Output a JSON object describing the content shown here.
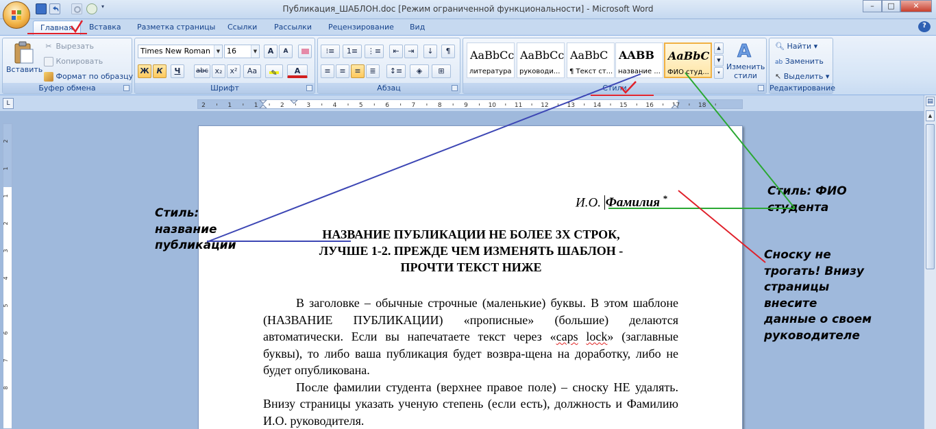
{
  "window": {
    "title": "Публикация_ШАБЛОН.doc [Режим ограниченной функциональности] - Microsoft Word",
    "minimize": "–",
    "maximize": "□",
    "close": "✕",
    "help": "?"
  },
  "tabs": [
    "Главная",
    "Вставка",
    "Разметка страницы",
    "Ссылки",
    "Рассылки",
    "Рецензирование",
    "Вид"
  ],
  "clipboard": {
    "label": "Буфер обмена",
    "paste": "Вставить",
    "cut": "Вырезать",
    "copy": "Копировать",
    "format_painter": "Формат по образцу"
  },
  "font": {
    "label": "Шрифт",
    "name": "Times New Roman",
    "size": "16",
    "grow": "A",
    "shrink": "A",
    "bold": "Ж",
    "italic": "К",
    "underline": "Ч",
    "strike": "abc",
    "subscript": "x₂",
    "superscript": "x²",
    "change_case": "Aa",
    "font_color": "A"
  },
  "paragraph": {
    "label": "Абзац"
  },
  "styles": {
    "label": "Стили",
    "change_styles": [
      "Изменить",
      "стили"
    ],
    "items": [
      {
        "sample": "AaBbCc",
        "name": "литература"
      },
      {
        "sample": "AaBbCc",
        "name": "руководи..."
      },
      {
        "sample": "AaBbC",
        "name": "¶ Текст ст..."
      },
      {
        "sample": "AABB",
        "name": "название ..."
      },
      {
        "sample": "AaBbC",
        "name": "ФИО студ..."
      }
    ]
  },
  "editing": {
    "label": "Редактирование",
    "find": "Найти",
    "replace": "Заменить",
    "select": "Выделить"
  },
  "ruler": {
    "corner": "L",
    "numbers": [
      "2",
      "1",
      "1",
      "2",
      "3",
      "4",
      "5",
      "6",
      "7",
      "8",
      "9",
      "10",
      "11",
      "12",
      "13",
      "14",
      "15",
      "16",
      "17",
      "18"
    ],
    "vnumbers": [
      "2",
      "1",
      "1",
      "2",
      "3",
      "4",
      "5",
      "6",
      "7",
      "8"
    ]
  },
  "document": {
    "author_initials": "И.О.",
    "author_surname": "Фамилия",
    "footnote_mark": "*",
    "heading": [
      "НАЗВАНИЕ ПУБЛИКАЦИИ НЕ БОЛЕЕ 3Х СТРОК,",
      "ЛУЧШЕ 1-2. ПРЕЖДЕ ЧЕМ ИЗМЕНЯТЬ ШАБЛОН -",
      "ПРОЧТИ ТЕКСТ НИЖЕ"
    ],
    "p1a": "В заголовке – обычные строчные (маленькие) буквы. В этом шаблоне (НАЗВАНИЕ ПУБЛИКАЦИИ) «прописные» (большие) делаются автоматически. Если вы напечатаете текст через «",
    "p1_caps": "caps",
    "p1_lock": "lock",
    "p1b": "» (заглавные буквы), то либо ваша публикация будет возвра-щена на доработку, либо не будет опубликована.",
    "p2": "После фамилии студента (верхнее правое поле) – сноску НЕ удалять. Внизу страницы указать ученую степень (если есть), должность и Фамилию И.О. руководителя."
  },
  "annotations": {
    "style_title": [
      "Стиль:",
      "название",
      "публикации"
    ],
    "style_fio": [
      "Стиль: ФИО",
      "студента"
    ],
    "footnote": [
      "Сноску не",
      "трогать! Внизу",
      "страницы",
      "внесите",
      "данные о своем",
      "руководителе"
    ]
  },
  "colors": {
    "annotation_blue": "#3c46b4",
    "annotation_green": "#2aa832",
    "annotation_red": "#e0202a",
    "check_red": "#e0202a"
  }
}
